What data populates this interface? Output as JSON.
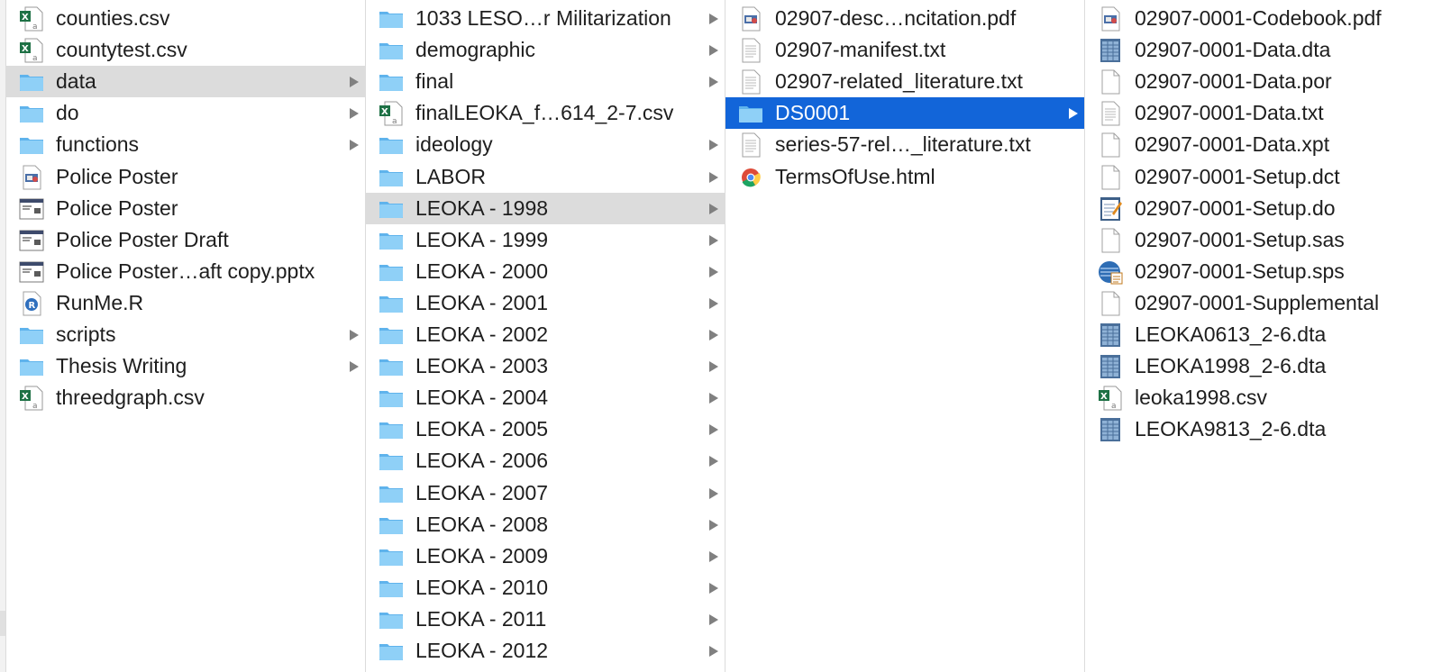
{
  "colors": {
    "selection_blue": "#1265d9",
    "selection_gray": "#dcdcdc",
    "folder": "#73c2f5"
  },
  "columns": [
    {
      "name": "col-1",
      "items": [
        {
          "label": "counties.csv",
          "icon": "excel-csv-icon"
        },
        {
          "label": "countytest.csv",
          "icon": "excel-csv-icon"
        },
        {
          "label": "data",
          "icon": "folder-icon",
          "chevron": true,
          "selected": "gray"
        },
        {
          "label": "do",
          "icon": "folder-icon",
          "chevron": true
        },
        {
          "label": "functions",
          "icon": "folder-icon",
          "chevron": true
        },
        {
          "label": "Police Poster",
          "icon": "preview-icon"
        },
        {
          "label": "Police Poster",
          "icon": "presentation-icon"
        },
        {
          "label": "Police Poster Draft",
          "icon": "presentation-icon"
        },
        {
          "label": "Police Poster…aft copy.pptx",
          "icon": "presentation-icon"
        },
        {
          "label": "RunMe.R",
          "icon": "r-script-icon"
        },
        {
          "label": "scripts",
          "icon": "folder-icon",
          "chevron": true
        },
        {
          "label": "Thesis Writing",
          "icon": "folder-icon",
          "chevron": true
        },
        {
          "label": "threedgraph.csv",
          "icon": "excel-csv-icon"
        }
      ]
    },
    {
      "name": "col-2",
      "items": [
        {
          "label": "1033 LESO…r Militarization",
          "icon": "folder-icon",
          "chevron": true
        },
        {
          "label": "demographic",
          "icon": "folder-icon",
          "chevron": true
        },
        {
          "label": "final",
          "icon": "folder-icon",
          "chevron": true
        },
        {
          "label": "finalLEOKA_f…614_2-7.csv",
          "icon": "excel-csv-icon"
        },
        {
          "label": "ideology",
          "icon": "folder-icon",
          "chevron": true
        },
        {
          "label": "LABOR",
          "icon": "folder-icon",
          "chevron": true
        },
        {
          "label": "LEOKA - 1998",
          "icon": "folder-icon",
          "chevron": true,
          "selected": "gray"
        },
        {
          "label": "LEOKA - 1999",
          "icon": "folder-icon",
          "chevron": true
        },
        {
          "label": "LEOKA - 2000",
          "icon": "folder-icon",
          "chevron": true
        },
        {
          "label": "LEOKA - 2001",
          "icon": "folder-icon",
          "chevron": true
        },
        {
          "label": "LEOKA - 2002",
          "icon": "folder-icon",
          "chevron": true
        },
        {
          "label": "LEOKA - 2003",
          "icon": "folder-icon",
          "chevron": true
        },
        {
          "label": "LEOKA - 2004",
          "icon": "folder-icon",
          "chevron": true
        },
        {
          "label": "LEOKA - 2005",
          "icon": "folder-icon",
          "chevron": true
        },
        {
          "label": "LEOKA - 2006",
          "icon": "folder-icon",
          "chevron": true
        },
        {
          "label": "LEOKA - 2007",
          "icon": "folder-icon",
          "chevron": true
        },
        {
          "label": "LEOKA - 2008",
          "icon": "folder-icon",
          "chevron": true
        },
        {
          "label": "LEOKA - 2009",
          "icon": "folder-icon",
          "chevron": true
        },
        {
          "label": "LEOKA - 2010",
          "icon": "folder-icon",
          "chevron": true
        },
        {
          "label": "LEOKA - 2011",
          "icon": "folder-icon",
          "chevron": true
        },
        {
          "label": "LEOKA - 2012",
          "icon": "folder-icon",
          "chevron": true
        }
      ]
    },
    {
      "name": "col-3",
      "items": [
        {
          "label": "02907-desc…ncitation.pdf",
          "icon": "preview-icon"
        },
        {
          "label": "02907-manifest.txt",
          "icon": "text-file-icon"
        },
        {
          "label": "02907-related_literature.txt",
          "icon": "text-file-icon"
        },
        {
          "label": "DS0001",
          "icon": "folder-icon",
          "chevron": true,
          "selected": "blue"
        },
        {
          "label": "series-57-rel…_literature.txt",
          "icon": "text-file-icon"
        },
        {
          "label": "TermsOfUse.html",
          "icon": "chrome-icon"
        }
      ]
    },
    {
      "name": "col-4",
      "items": [
        {
          "label": "02907-0001-Codebook.pdf",
          "icon": "preview-icon"
        },
        {
          "label": "02907-0001-Data.dta",
          "icon": "stata-data-icon"
        },
        {
          "label": "02907-0001-Data.por",
          "icon": "blank-file-icon"
        },
        {
          "label": "02907-0001-Data.txt",
          "icon": "text-file-icon"
        },
        {
          "label": "02907-0001-Data.xpt",
          "icon": "blank-file-icon"
        },
        {
          "label": "02907-0001-Setup.dct",
          "icon": "blank-file-icon"
        },
        {
          "label": "02907-0001-Setup.do",
          "icon": "stata-do-icon"
        },
        {
          "label": "02907-0001-Setup.sas",
          "icon": "blank-file-icon"
        },
        {
          "label": "02907-0001-Setup.sps",
          "icon": "spss-icon"
        },
        {
          "label": "02907-0001-Supplemental",
          "icon": "blank-file-icon"
        },
        {
          "label": "LEOKA0613_2-6.dta",
          "icon": "stata-data-icon"
        },
        {
          "label": "LEOKA1998_2-6.dta",
          "icon": "stata-data-icon"
        },
        {
          "label": "leoka1998.csv",
          "icon": "excel-csv-icon"
        },
        {
          "label": "LEOKA9813_2-6.dta",
          "icon": "stata-data-icon"
        }
      ]
    }
  ]
}
